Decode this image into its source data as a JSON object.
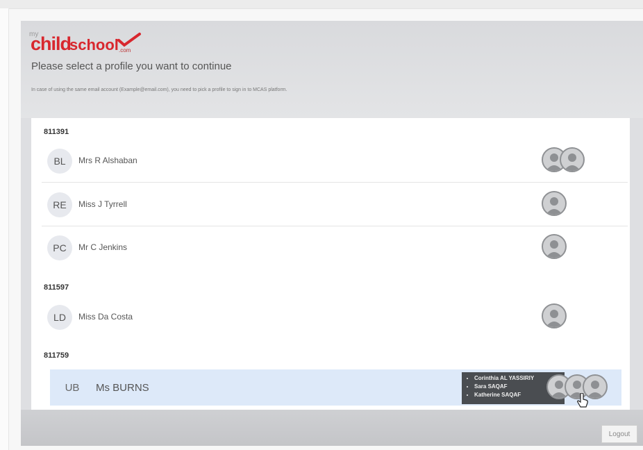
{
  "brand": {
    "prefix": "my",
    "name_part1": "child",
    "name_part2": "school",
    "suffix": ".com"
  },
  "header": {
    "title": "Please select a profile you want to continue",
    "note": "In case of using the same email account (Example@email.com), you need to pick a profile to sign in to MCAS platform."
  },
  "groups": [
    {
      "id": "811391",
      "profiles": [
        {
          "initials": "BL",
          "name": "Mrs R Alshaban",
          "children": 2
        },
        {
          "initials": "RE",
          "name": "Miss J Tyrrell",
          "children": 1
        },
        {
          "initials": "PC",
          "name": "Mr C Jenkins",
          "children": 1
        }
      ]
    },
    {
      "id": "811597",
      "profiles": [
        {
          "initials": "LD",
          "name": "Miss Da Costa",
          "children": 1
        }
      ]
    },
    {
      "id": "811759",
      "profiles": [
        {
          "initials": "UB",
          "name": "Ms BURNS",
          "children": 3,
          "tooltip": [
            "Corinthia AL YASSIRIY",
            "Sara SAQAF",
            "Katherine SAQAF"
          ]
        }
      ]
    }
  ],
  "footer": {
    "logout_label": "Logout"
  },
  "icons": {
    "child": "person-silhouette-icon",
    "cursor": "hand-pointer-icon",
    "tick": "checkmark-icon"
  },
  "colors": {
    "brand_red": "#d8272e",
    "active_row": "#dde9f9",
    "tooltip_bg": "#4a4d51"
  }
}
